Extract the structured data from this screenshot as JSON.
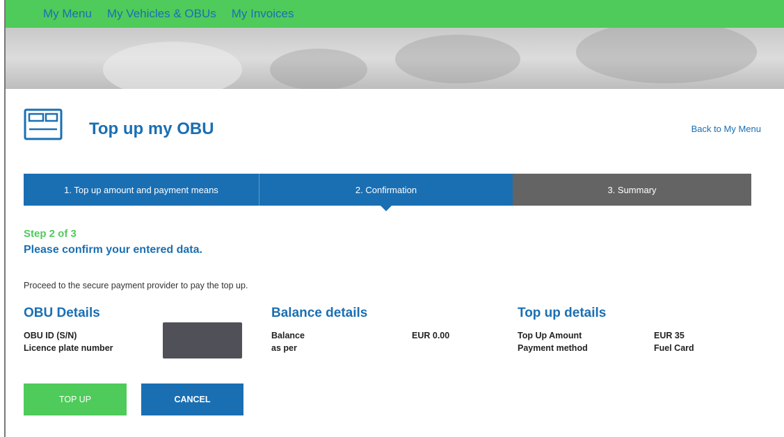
{
  "nav": {
    "items": [
      "My Menu",
      "My Vehicles & OBUs",
      "My Invoices"
    ]
  },
  "header": {
    "title": "Top up my OBU",
    "back_link": "Back to My Menu",
    "icon": "obu-device-icon"
  },
  "steps": [
    {
      "label": "1. Top up amount and payment means",
      "state": "done"
    },
    {
      "label": "2. Confirmation",
      "state": "active"
    },
    {
      "label": "3. Summary",
      "state": "pending"
    }
  ],
  "main": {
    "step_label": "Step 2 of 3",
    "confirm_text": "Please confirm your entered data.",
    "proceed_text": "Proceed to the secure payment provider to pay the top up."
  },
  "obu_details": {
    "heading": "OBU Details",
    "rows": [
      {
        "label": "OBU ID (S/N)",
        "value": ""
      },
      {
        "label": "Licence plate number",
        "value": ""
      }
    ]
  },
  "balance_details": {
    "heading": "Balance details",
    "rows": [
      {
        "label": "Balance",
        "value": "EUR 0.00"
      },
      {
        "label": "as per",
        "value": ""
      }
    ]
  },
  "topup_details": {
    "heading": "Top up details",
    "rows": [
      {
        "label": "Top Up Amount",
        "value": "EUR 35"
      },
      {
        "label": "Payment method",
        "value": "Fuel Card"
      }
    ]
  },
  "buttons": {
    "topup": "TOP UP",
    "cancel": "CANCEL"
  },
  "colors": {
    "brand_green": "#4ecb5a",
    "brand_blue": "#1a6fb3",
    "step_inactive": "#646464",
    "redaction": "#505158"
  }
}
